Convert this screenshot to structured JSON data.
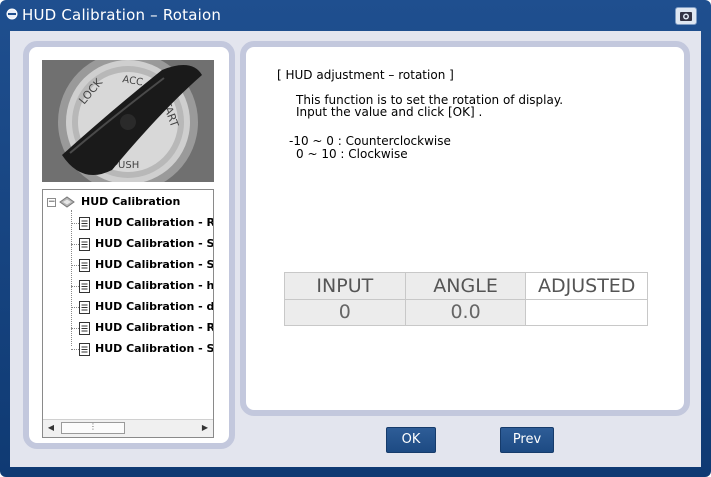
{
  "window": {
    "title": "HUD Calibration – Rotaion"
  },
  "tree": {
    "root_label": "HUD Calibration",
    "items": [
      "HUD Calibration - Ro",
      "HUD Calibration - Sm",
      "HUD Calibration - Slo",
      "HUD Calibration - hor",
      "HUD Calibration - dis",
      "HUD Calibration - Re",
      "HUD Calibration - Slo"
    ]
  },
  "info": {
    "title": "[ HUD adjustment – rotation ]",
    "line1": "This function is to set the rotation of display.",
    "line2": "Input the value and click [OK] .",
    "range1": "-10 ~ 0 : Counterclockwise",
    "range2": "0 ~ 10 : Clockwise"
  },
  "grid": {
    "headers": [
      "INPUT",
      "ANGLE",
      "ADJUSTED"
    ],
    "values": [
      "0",
      "0.0",
      ""
    ]
  },
  "buttons": {
    "ok": "OK",
    "prev": "Prev"
  },
  "colors": {
    "title_bar": "#1f4f8f",
    "button": "#2e5d97",
    "panel_border": "#c3c8dd"
  }
}
